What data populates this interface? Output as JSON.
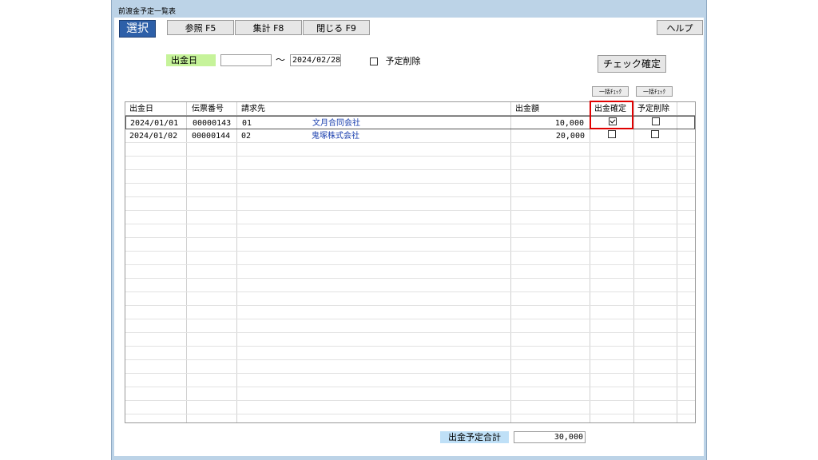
{
  "window": {
    "title": "前渡金予定一覧表"
  },
  "toolbar": {
    "select_label": "選択",
    "ref_label": "参照 F5",
    "agg_label": "集計 F8",
    "close_label": "閉じる F9",
    "help_label": "ヘルプ"
  },
  "filter": {
    "date_label": "出金日",
    "date_from": "",
    "tilde": "～",
    "date_to": "2024/02/28",
    "delete_plan_label": "予定削除",
    "delete_plan_checked": false,
    "confirm_check_label": "チェック確定",
    "bulk_check_1": "一括ﾁｪｯｸ",
    "bulk_check_2": "一括ﾁｪｯｸ"
  },
  "table": {
    "headers": [
      "出金日",
      "伝票番号",
      "請求先",
      "",
      "出金額",
      "出金確定",
      "予定削除"
    ],
    "rows": [
      {
        "date": "2024/01/01",
        "slip": "00000143",
        "code": "01",
        "name": "文月合同会社",
        "amount": "10,000",
        "confirm": true,
        "delete": false
      },
      {
        "date": "2024/01/02",
        "slip": "00000144",
        "code": "02",
        "name": "鬼塚株式会社",
        "amount": "20,000",
        "confirm": false,
        "delete": false
      }
    ]
  },
  "footer": {
    "total_label": "出金予定合計",
    "total_value": "30,000"
  }
}
